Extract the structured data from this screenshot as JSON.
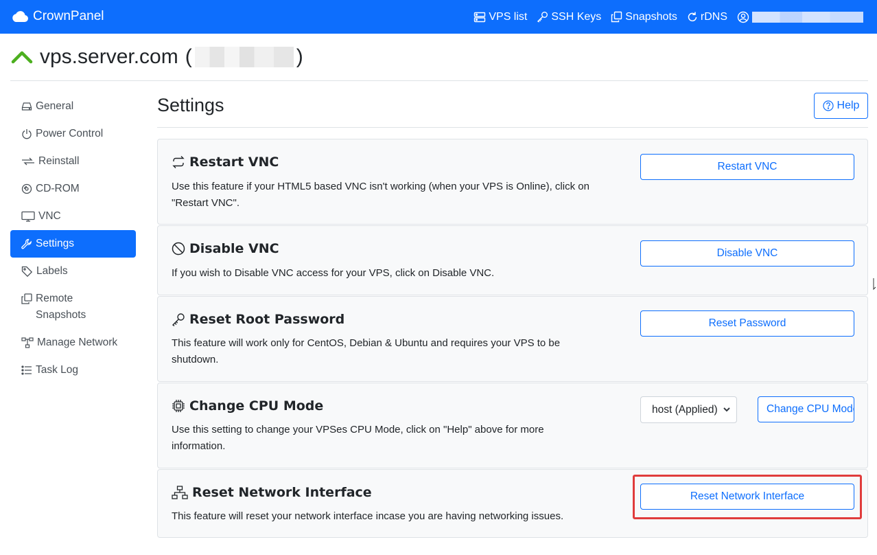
{
  "navbar": {
    "brand": "CrownPanel",
    "links": [
      {
        "label": "VPS list",
        "icon": "server-icon"
      },
      {
        "label": "SSH Keys",
        "icon": "key-icon"
      },
      {
        "label": "Snapshots",
        "icon": "copy-icon"
      },
      {
        "label": "rDNS",
        "icon": "refresh-icon"
      }
    ],
    "user_icon": "user-circle-icon"
  },
  "header": {
    "hostname": "vps.server.com",
    "open_paren": "(",
    "close_paren": ")",
    "status_icon": "chevron-up-icon",
    "status_color": "#4caf1f"
  },
  "sidebar": {
    "items": [
      {
        "label": "General",
        "icon": "hdd-icon"
      },
      {
        "label": "Power Control",
        "icon": "power-icon"
      },
      {
        "label": "Reinstall",
        "icon": "arrows-icon"
      },
      {
        "label": "CD-ROM",
        "icon": "disc-icon"
      },
      {
        "label": "VNC",
        "icon": "display-icon"
      },
      {
        "label": "Settings",
        "icon": "wrench-icon",
        "active": true
      },
      {
        "label": "Labels",
        "icon": "tag-icon"
      },
      {
        "label": "Remote Snapshots",
        "icon": "copy-icon"
      },
      {
        "label": "Manage Network",
        "icon": "diagram-icon"
      },
      {
        "label": "Task Log",
        "icon": "list-icon"
      }
    ]
  },
  "main": {
    "title": "Settings",
    "help_label": "Help",
    "cards": [
      {
        "title": "Restart VNC",
        "icon": "arrow-repeat-icon",
        "desc": "Use this feature if your HTML5 based VNC isn't working (when your VPS is Online), click on \"Restart VNC\".",
        "button": "Restart VNC"
      },
      {
        "title": "Disable VNC",
        "icon": "slash-circle-icon",
        "desc": "If you wish to Disable VNC access for your VPS, click on Disable VNC.",
        "button": "Disable VNC"
      },
      {
        "title": "Reset Root Password",
        "icon": "key-icon",
        "desc": "This feature will work only for CentOS, Debian & Ubuntu and requires your VPS to be shutdown.",
        "button": "Reset Password"
      },
      {
        "title": "Change CPU Mode",
        "icon": "cpu-icon",
        "desc": "Use this setting to change your VPSes CPU Mode, click on \"Help\" above for more information.",
        "select_value": "host (Applied)",
        "button": "Change CPU Mode"
      },
      {
        "title": "Reset Network Interface",
        "icon": "diagram-icon",
        "desc": "This feature will reset your network interface incase you are having networking issues.",
        "button": "Reset Network Interface"
      }
    ]
  },
  "colors": {
    "primary": "#0d6efd",
    "highlight": "#e03c3c"
  }
}
